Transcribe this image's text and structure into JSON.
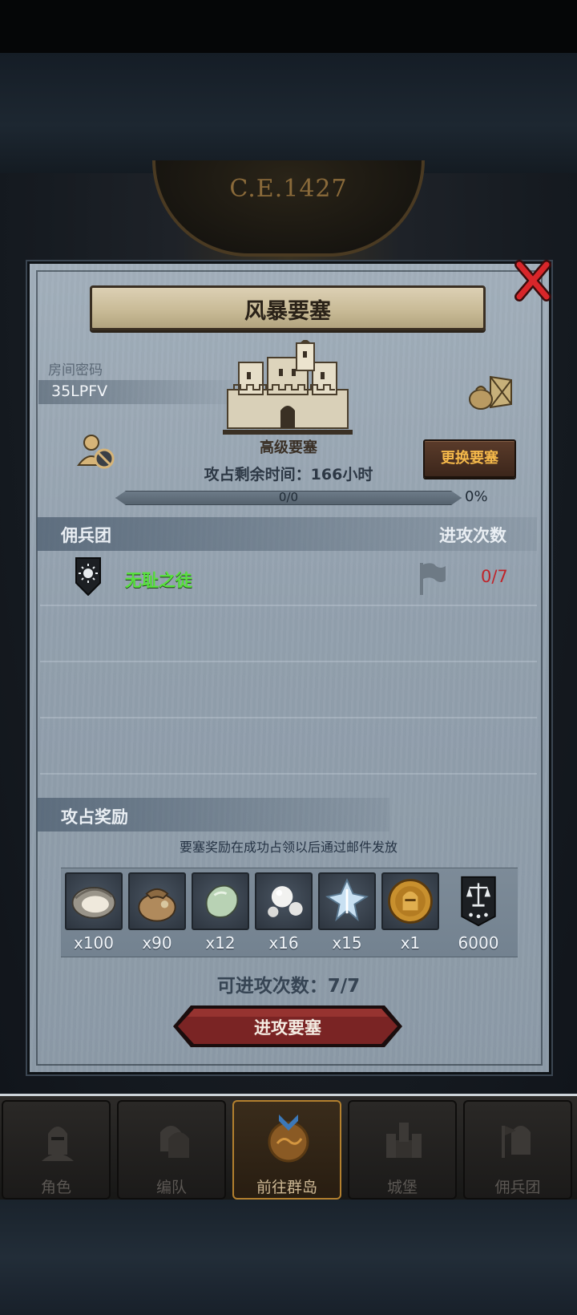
{
  "era": "C.E.1427",
  "dialog": {
    "title": "风暴要塞",
    "room_label": "房间密码",
    "room_code": "35LPFV",
    "fortress_type": "高级要塞",
    "change_button": "更换要塞",
    "remaining_time": "攻占剩余时间：166小时",
    "progress": {
      "text": "0/0",
      "percent_label": "0%",
      "fraction": 0
    },
    "mercenary_header": "佣兵团",
    "attacks_header": "进攻次数",
    "members": [
      {
        "name": "无耻之徒",
        "count": "0/7",
        "name_color": "#58e03e",
        "count_color": "#c0242a",
        "emblem": "sun-shield-icon"
      }
    ],
    "rewards_header": "攻占奖励",
    "rewards_note": "要塞奖励在成功占领以后通过邮件发放",
    "rewards": [
      {
        "icon": "oyster-icon",
        "qty": "x100"
      },
      {
        "icon": "sack-icon",
        "qty": "x90"
      },
      {
        "icon": "gem-stone-icon",
        "qty": "x12"
      },
      {
        "icon": "pearls-icon",
        "qty": "x16"
      },
      {
        "icon": "ice-crystal-icon",
        "qty": "x15"
      },
      {
        "icon": "knight-coin-icon",
        "qty": "x1"
      },
      {
        "icon": "justice-banner-icon",
        "qty": "6000"
      }
    ],
    "available_attacks": "可进攻次数：7/7",
    "attack_button": "进攻要塞"
  },
  "nav": [
    {
      "label": "角色",
      "icon": "knight-helmet-icon",
      "active": false
    },
    {
      "label": "编队",
      "icon": "formation-icon",
      "active": false
    },
    {
      "label": "前往群岛",
      "icon": "islands-compass-icon",
      "active": true
    },
    {
      "label": "城堡",
      "icon": "castle-icon",
      "active": false
    },
    {
      "label": "佣兵团",
      "icon": "mercenary-icon",
      "active": false
    }
  ]
}
